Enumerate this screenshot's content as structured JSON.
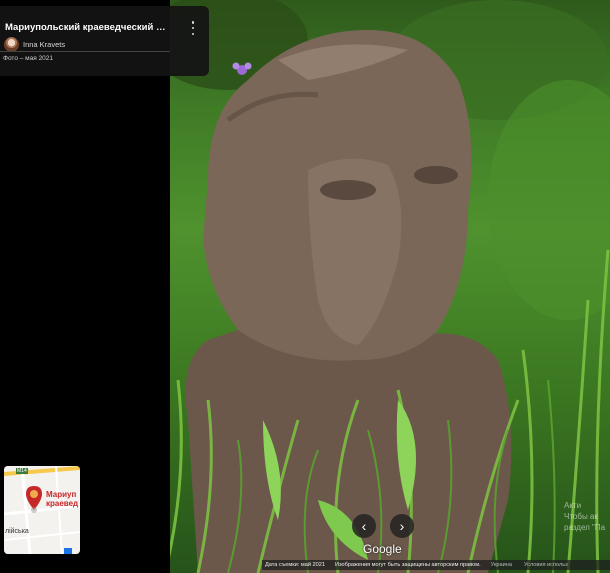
{
  "place": {
    "title": "Мариупольский краеведческий му...",
    "author": "Inna Kravets",
    "photo_date": "Фото – мая 2021"
  },
  "icons": {
    "more": "more-vert-icon",
    "prev": "chevron-left-icon",
    "next": "chevron-right-icon",
    "pin": "map-pin-icon"
  },
  "minimap": {
    "label_line1": "Мариуп",
    "label_line2": "краевед",
    "street": "лійська",
    "road_badge": "M14"
  },
  "navigation": {
    "prev_glyph": "‹",
    "next_glyph": "›"
  },
  "brand": {
    "logo": "Google"
  },
  "footer": {
    "capture_date": "Дата съемки: май 2021",
    "copyright": "Изображения могут быть защищены авторским правом.",
    "country": "Украина",
    "terms": "Условия использ"
  },
  "watermark": {
    "line1": "Акти",
    "line2": "Чтобы ак",
    "line3": "раздел \"Па"
  },
  "colors": {
    "panel": "#000000",
    "card": "#141414",
    "pin": "#c62828"
  }
}
